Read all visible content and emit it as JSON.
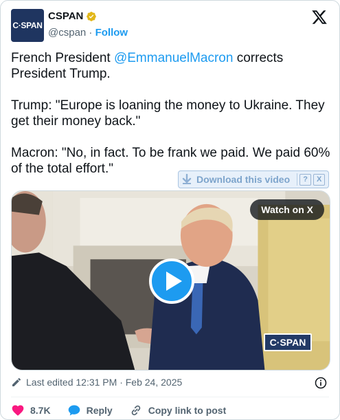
{
  "author": {
    "display_name": "CSPAN",
    "avatar_text": "C·SPAN",
    "handle": "@cspan",
    "separator": " · ",
    "follow_label": "Follow",
    "verified_badge_color": "#e2b719",
    "icons": {
      "verified": "gold-verified-badge-icon",
      "platform": "x-logo-icon"
    }
  },
  "tweet": {
    "line1_before": "French President ",
    "mention": "@EmmanuelMacron",
    "line1_after": " corrects President Trump.",
    "paragraph2": "Trump: \"Europe is loaning the money to Ukraine. They get their money back.\"",
    "paragraph3": "Macron: \"No, in fact. To be frank we paid. We paid 60% of the total effort.\""
  },
  "download_overlay": {
    "label": "Download this video",
    "help": "?",
    "close": "X"
  },
  "media": {
    "watch_label": "Watch on X",
    "play_icon": "play-button-icon",
    "channel_bug": "C·SPAN"
  },
  "meta": {
    "edited_text": "Last edited 12:31 PM · Feb 24, 2025",
    "edit_icon": "pencil-icon",
    "info_icon": "info-icon"
  },
  "actions": {
    "like_count": "8.7K",
    "reply_label": "Reply",
    "copy_label": "Copy link to post",
    "like_color": "#f91880",
    "reply_color": "#1d9bf0"
  },
  "colors": {
    "link": "#1d9bf0",
    "secondary_text": "#536471",
    "avatar_bg": "#1f3560"
  }
}
